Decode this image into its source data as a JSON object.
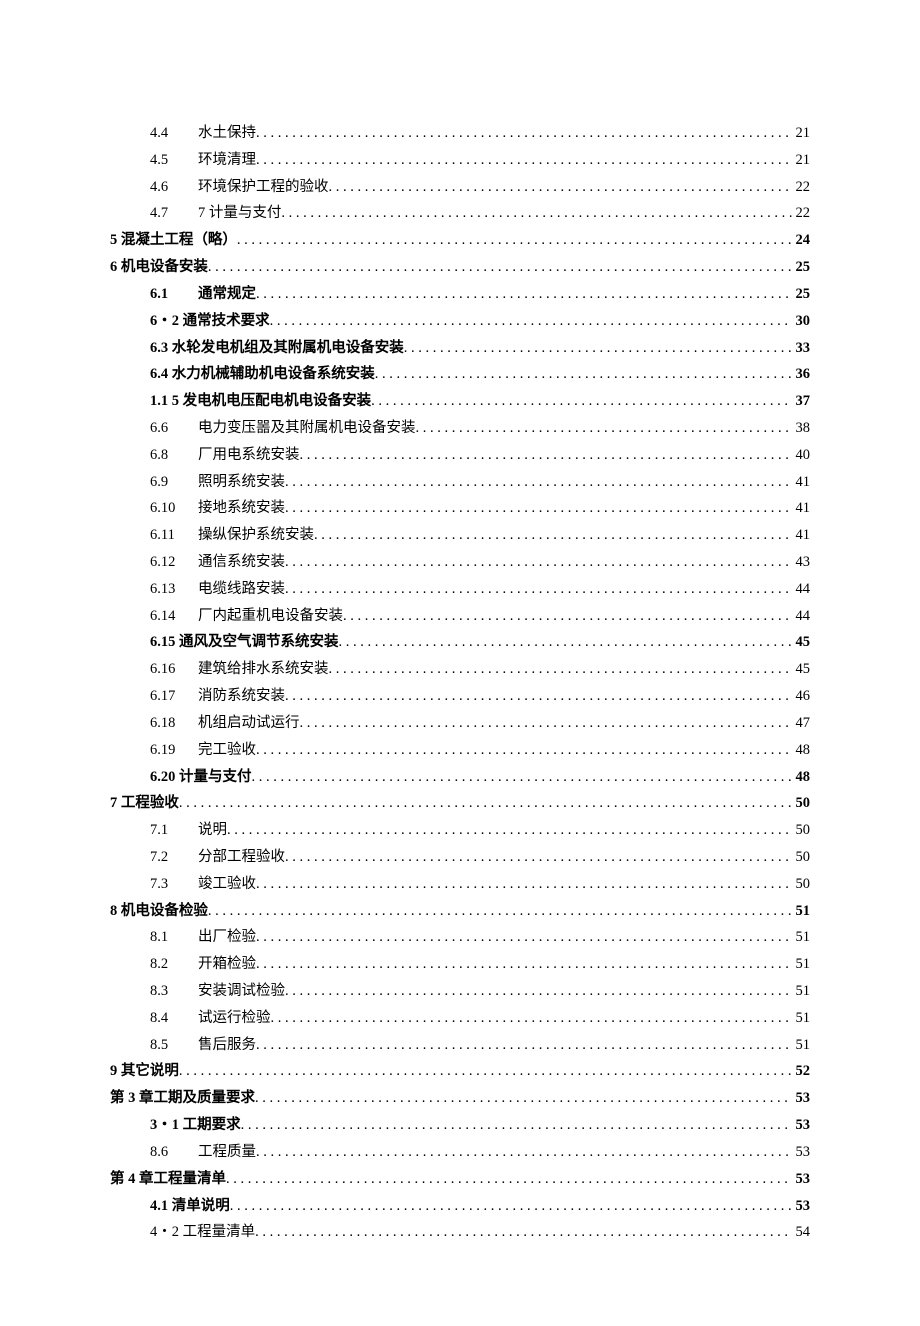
{
  "toc": [
    {
      "indent": 1,
      "bold": false,
      "prefix": "4.4",
      "title": "水土保持",
      "page": "21"
    },
    {
      "indent": 1,
      "bold": false,
      "prefix": "4.5",
      "title": "环境清理",
      "page": "21"
    },
    {
      "indent": 1,
      "bold": false,
      "prefix": "4.6",
      "title": "环境保护工程的验收",
      "page": "22"
    },
    {
      "indent": 1,
      "bold": false,
      "prefix": "4.7",
      "title": "7 计量与支付",
      "page": "22"
    },
    {
      "indent": 0,
      "bold": true,
      "prefix": "",
      "title": "5 混凝土工程（略）",
      "page": "24"
    },
    {
      "indent": 0,
      "bold": true,
      "prefix": "",
      "title": "6 机电设备安装",
      "page": "25"
    },
    {
      "indent": 1,
      "bold": true,
      "prefix": "6.1",
      "title": "通常规定",
      "page": "25"
    },
    {
      "indent": 1,
      "bold": true,
      "prefix": "",
      "title": "6・2 通常技术要求",
      "page": "30"
    },
    {
      "indent": 1,
      "bold": true,
      "prefix": "",
      "title": "6.3 水轮发电机组及其附属机电设备安装",
      "page": "33"
    },
    {
      "indent": 1,
      "bold": true,
      "prefix": "",
      "title": "6.4 水力机械辅助机电设备系统安装",
      "page": "36"
    },
    {
      "indent": 1,
      "bold": true,
      "prefix": "",
      "title": "1.1  5 发电机电压配电机电设备安装",
      "page": "37"
    },
    {
      "indent": 1,
      "bold": false,
      "prefix": "6.6",
      "title": "电力变压噐及其附属机电设备安装",
      "page": "38"
    },
    {
      "indent": 1,
      "bold": false,
      "prefix": "6.8",
      "title": "厂用电系统安装",
      "page": "40"
    },
    {
      "indent": 1,
      "bold": false,
      "prefix": "6.9",
      "title": "照明系统安装",
      "page": "41"
    },
    {
      "indent": 1,
      "bold": false,
      "prefix": "6.10",
      "title": "接地系统安装",
      "page": "41"
    },
    {
      "indent": 1,
      "bold": false,
      "prefix": "6.11",
      "title": "操纵保护系统安装",
      "page": "41"
    },
    {
      "indent": 1,
      "bold": false,
      "prefix": "6.12",
      "title": "通信系统安装",
      "page": "43"
    },
    {
      "indent": 1,
      "bold": false,
      "prefix": "6.13",
      "title": "电缆线路安装",
      "page": "44"
    },
    {
      "indent": 1,
      "bold": false,
      "prefix": "6.14",
      "title": "厂内起重机电设备安装",
      "page": "44"
    },
    {
      "indent": 1,
      "bold": true,
      "prefix": "",
      "title": "6.15 通风及空气调节系统安装",
      "page": "45"
    },
    {
      "indent": 1,
      "bold": false,
      "prefix": "6.16",
      "title": "建筑给排水系统安装",
      "page": "45"
    },
    {
      "indent": 1,
      "bold": false,
      "prefix": "6.17",
      "title": "消防系统安装",
      "page": "46"
    },
    {
      "indent": 1,
      "bold": false,
      "prefix": "6.18",
      "title": "机组启动试运行",
      "page": "47"
    },
    {
      "indent": 1,
      "bold": false,
      "prefix": "6.19",
      "title": "完工验收",
      "page": "48"
    },
    {
      "indent": 1,
      "bold": true,
      "prefix": "",
      "title": "6.20 计量与支付",
      "page": "48"
    },
    {
      "indent": 0,
      "bold": true,
      "prefix": "",
      "title": "7 工程验收",
      "page": "50"
    },
    {
      "indent": 1,
      "bold": false,
      "prefix": "7.1",
      "title": "说明",
      "page": "50"
    },
    {
      "indent": 1,
      "bold": false,
      "prefix": "7.2",
      "title": "分部工程验收",
      "page": "50"
    },
    {
      "indent": 1,
      "bold": false,
      "prefix": "7.3",
      "title": "竣工验收",
      "page": "50"
    },
    {
      "indent": 0,
      "bold": true,
      "prefix": "",
      "title": "8 机电设备检验",
      "page": "51"
    },
    {
      "indent": 1,
      "bold": false,
      "prefix": "8.1",
      "title": "出厂检验",
      "page": "51"
    },
    {
      "indent": 1,
      "bold": false,
      "prefix": "8.2",
      "title": "开箱检验",
      "page": "51"
    },
    {
      "indent": 1,
      "bold": false,
      "prefix": "8.3",
      "title": "安装调试检验",
      "page": "51"
    },
    {
      "indent": 1,
      "bold": false,
      "prefix": "8.4",
      "title": "试运行检验",
      "page": "51"
    },
    {
      "indent": 1,
      "bold": false,
      "prefix": "8.5",
      "title": "售后服务",
      "page": "51"
    },
    {
      "indent": 0,
      "bold": true,
      "prefix": "",
      "title": "9 其它说明",
      "page": "52"
    },
    {
      "indent": -1,
      "bold": true,
      "prefix": "",
      "title": "第 3 章工期及质量要求",
      "page": "53"
    },
    {
      "indent": 1,
      "bold": true,
      "prefix": "",
      "title": "3・1 工期要求",
      "page": "53"
    },
    {
      "indent": 1,
      "bold": false,
      "prefix": "8.6",
      "title": "工程质量",
      "page": "53"
    },
    {
      "indent": -1,
      "bold": true,
      "prefix": "",
      "title": "第 4 章工程量清单",
      "page": "53"
    },
    {
      "indent": 1,
      "bold": true,
      "prefix": "",
      "title": "4.1 清单说明",
      "page": "53"
    },
    {
      "indent": 1,
      "bold": false,
      "prefix": "",
      "title": "4・2 工程量清单",
      "page": "54"
    }
  ]
}
